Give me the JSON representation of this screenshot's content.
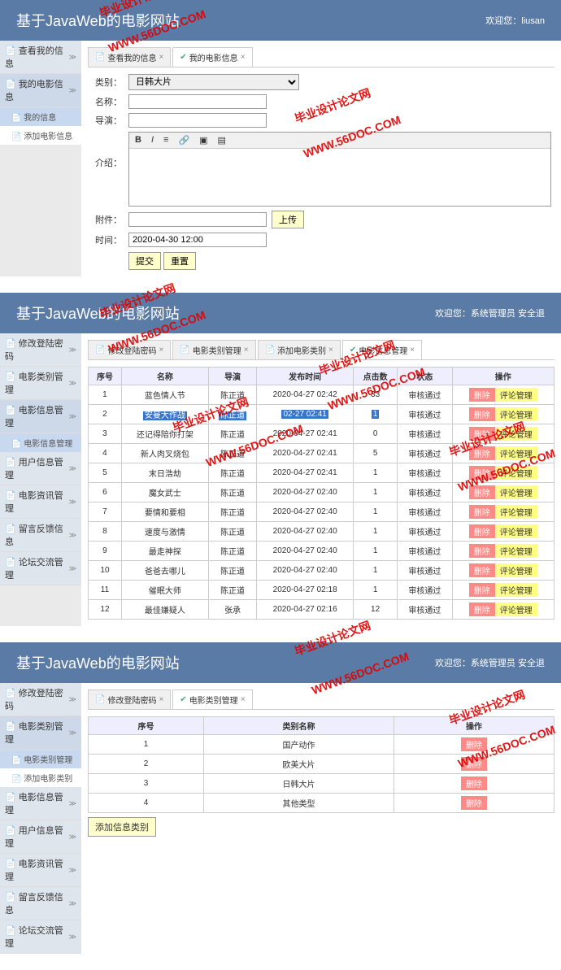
{
  "watermark": {
    "text1": "毕业设计论文网",
    "url": "WWW.56DOC.COM"
  },
  "panel1": {
    "title": "基于JavaWeb的电影网站",
    "welcome": "欢迎您：liusan",
    "sidebar": [
      {
        "label": "查看我的信息",
        "type": "item"
      },
      {
        "label": "我的电影信息",
        "type": "item",
        "active": true
      },
      {
        "label": "我的信息",
        "type": "sub",
        "active": true
      },
      {
        "label": "添加电影信息",
        "type": "sub"
      }
    ],
    "tabs": [
      {
        "label": "查看我的信息",
        "active": false
      },
      {
        "label": "我的电影信息",
        "active": true,
        "check": true
      }
    ],
    "form": {
      "type_label": "类别：",
      "type_value": "日韩大片",
      "name_label": "名称：",
      "director_label": "导演：",
      "intro_label": "介绍：",
      "attach_label": "附件：",
      "upload_btn": "上传",
      "time_label": "时间：",
      "time_value": "2020-04-30 12:00",
      "submit": "提交",
      "reset": "重置"
    }
  },
  "panel2": {
    "title": "基于JavaWeb的电影网站",
    "welcome": "欢迎您：系统管理员  安全退",
    "sidebar": [
      {
        "label": "修改登陆密码",
        "type": "item"
      },
      {
        "label": "电影类别管理",
        "type": "item"
      },
      {
        "label": "电影信息管理",
        "type": "item",
        "active": true
      },
      {
        "label": "电影信息管理",
        "type": "sub",
        "active": true
      },
      {
        "label": "用户信息管理",
        "type": "item"
      },
      {
        "label": "电影资讯管理",
        "type": "item"
      },
      {
        "label": "留言反馈信息",
        "type": "item"
      },
      {
        "label": "论坛交流管理",
        "type": "item"
      }
    ],
    "tabs": [
      {
        "label": "修改登陆密码"
      },
      {
        "label": "电影类别管理"
      },
      {
        "label": "添加电影类别"
      },
      {
        "label": "电影信息管理",
        "active": true,
        "check": true
      }
    ],
    "table": {
      "headers": [
        "序号",
        "名称",
        "导演",
        "发布时间",
        "点击数",
        "状态",
        "操作"
      ],
      "delete_label": "删除",
      "comment_label": "评论管理",
      "rows": [
        {
          "n": "1",
          "name": "蓝色情人节",
          "d": "陈正道",
          "t": "2020-04-27 02:42",
          "c": "33",
          "s": "审核通过"
        },
        {
          "n": "2",
          "name": "安曼大作战",
          "d": "陈正道",
          "t": "02-27 02:41",
          "c": "1",
          "s": "审核通过",
          "hl": true
        },
        {
          "n": "3",
          "name": "还记得陪你打架",
          "d": "陈正道",
          "t": "2020-04-27 02:41",
          "c": "0",
          "s": "审核通过"
        },
        {
          "n": "4",
          "name": "新人肉叉烧包",
          "d": "陈正道",
          "t": "2020-04-27 02:41",
          "c": "5",
          "s": "审核通过"
        },
        {
          "n": "5",
          "name": "末日浩劫",
          "d": "陈正道",
          "t": "2020-04-27 02:41",
          "c": "1",
          "s": "审核通过"
        },
        {
          "n": "6",
          "name": "魔女武士",
          "d": "陈正道",
          "t": "2020-04-27 02:40",
          "c": "1",
          "s": "审核通过"
        },
        {
          "n": "7",
          "name": "要情和要相",
          "d": "陈正道",
          "t": "2020-04-27 02:40",
          "c": "1",
          "s": "审核通过"
        },
        {
          "n": "8",
          "name": "速度与激情",
          "d": "陈正道",
          "t": "2020-04-27 02:40",
          "c": "1",
          "s": "审核通过"
        },
        {
          "n": "9",
          "name": "最走神探",
          "d": "陈正道",
          "t": "2020-04-27 02:40",
          "c": "1",
          "s": "审核通过"
        },
        {
          "n": "10",
          "name": "爸爸去哪儿",
          "d": "陈正道",
          "t": "2020-04-27 02:40",
          "c": "1",
          "s": "审核通过"
        },
        {
          "n": "11",
          "name": "催眠大师",
          "d": "陈正道",
          "t": "2020-04-27 02:18",
          "c": "1",
          "s": "审核通过"
        },
        {
          "n": "12",
          "name": "最佳嫌疑人",
          "d": "张承",
          "t": "2020-04-27 02:16",
          "c": "12",
          "s": "审核通过"
        }
      ]
    }
  },
  "panel3": {
    "title": "基于JavaWeb的电影网站",
    "welcome": "欢迎您：系统管理员  安全退",
    "sidebar_top": [
      {
        "label": "修改登陆密码",
        "type": "item"
      },
      {
        "label": "电影类别管理",
        "type": "item",
        "active": true
      },
      {
        "label": "电影类别管理",
        "type": "sub",
        "active": true
      },
      {
        "label": "添加电影类别",
        "type": "sub"
      }
    ],
    "sidebar_bottom": [
      {
        "label": "电影信息管理",
        "type": "item"
      },
      {
        "label": "用户信息管理",
        "type": "item"
      },
      {
        "label": "电影资讯管理",
        "type": "item"
      },
      {
        "label": "留言反馈信息",
        "type": "item"
      },
      {
        "label": "论坛交流管理",
        "type": "item"
      }
    ],
    "tabs": [
      {
        "label": "修改登陆密码"
      },
      {
        "label": "电影类别管理",
        "active": true,
        "check": true
      }
    ],
    "table": {
      "headers": [
        "序号",
        "类别名称",
        "操作"
      ],
      "delete_label": "删除",
      "rows": [
        {
          "n": "1",
          "name": "国产动作"
        },
        {
          "n": "2",
          "name": "欧美大片"
        },
        {
          "n": "3",
          "name": "日韩大片"
        },
        {
          "n": "4",
          "name": "其他类型"
        }
      ],
      "add_btn": "添加信息类别"
    }
  }
}
